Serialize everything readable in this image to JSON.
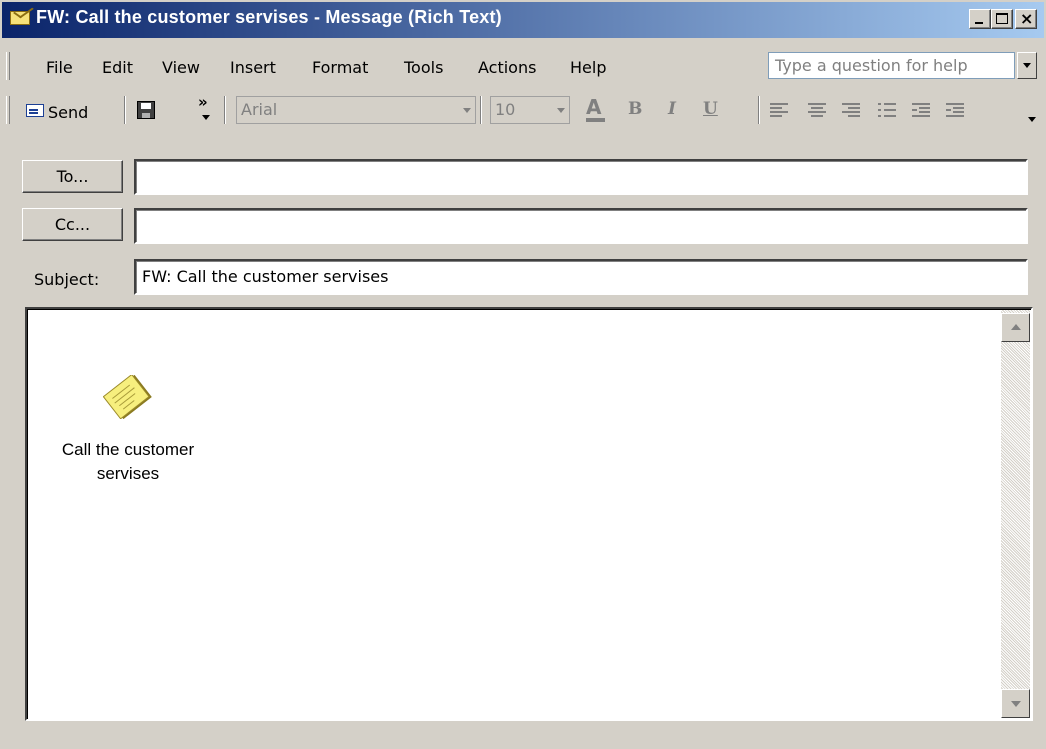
{
  "window": {
    "title": "FW: Call the customer servises - Message (Rich Text)",
    "close_glyph": "×"
  },
  "menu": {
    "items": [
      "File",
      "Edit",
      "View",
      "Insert",
      "Format",
      "Tools",
      "Actions",
      "Help"
    ],
    "help_placeholder": "Type a question for help"
  },
  "toolbar": {
    "send_label": "Send",
    "more_glyph": "»",
    "font_name": "Arial",
    "font_size": "10",
    "font_color_glyph": "A",
    "bold_glyph": "B",
    "italic_glyph": "I",
    "underline_glyph": "U"
  },
  "message": {
    "to_button": "To...",
    "cc_button": "Cc...",
    "to_value": "",
    "cc_value": "",
    "subject_label": "Subject:",
    "subject_value": "FW: Call the customer servises"
  },
  "attachment": {
    "label_line1": "Call the customer",
    "label_line2": "servises"
  }
}
